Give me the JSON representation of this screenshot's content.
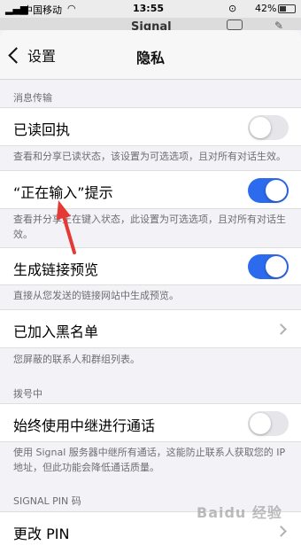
{
  "status_bar": {
    "carrier": "中国移动",
    "time": "13:55",
    "battery": "42%"
  },
  "behind": {
    "title": "Signal"
  },
  "navbar": {
    "back_label": "设置",
    "title": "隐私"
  },
  "sections": {
    "messaging_header": "消息传输",
    "read_receipts": {
      "label": "已读回执",
      "enabled": false,
      "footnote": "查看和分享已读状态，该设置为可选选项，且对所有对话生效。"
    },
    "typing_indicators": {
      "label": "“正在输入”提示",
      "enabled": true,
      "footnote": "查看并分享正在键入状态，此设置为可选选项，且对所有对话生效。"
    },
    "link_previews": {
      "label": "生成链接预览",
      "enabled": true,
      "footnote": "直接从您发送的链接网站中生成预览。"
    },
    "blocked": {
      "label": "已加入黑名单",
      "footnote": "您屏蔽的联系人和群组列表。"
    },
    "calling_header": "拨号中",
    "relay_calls": {
      "label": "始终使用中继进行通话",
      "enabled": false,
      "footnote": "使用 Signal 服务器中继所有通话，这能防止联系人获取您的 IP 地址，但此功能会降低通话质量。"
    },
    "pin_header": "SIGNAL PIN 码",
    "change_pin": {
      "label": "更改 PIN"
    }
  },
  "colors": {
    "toggle_on": "#2c6bed",
    "toggle_off": "#e6e6ea",
    "annotation_arrow": "#e53935"
  },
  "watermark": "Baidu 经验"
}
